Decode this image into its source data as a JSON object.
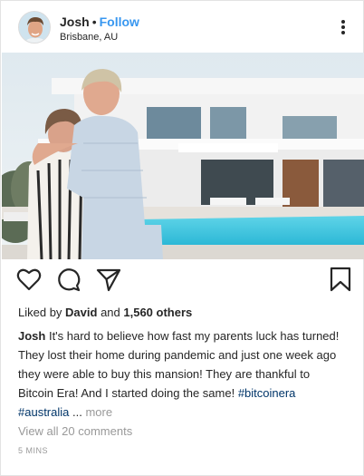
{
  "post": {
    "username": "Josh",
    "separator": "•",
    "follow_label": "Follow",
    "location": "Brisbane, AU",
    "more_icon": "more-vertical-icon"
  },
  "photo": {
    "description_icon": "post-photo"
  },
  "actions": {
    "like_icon": "heart-icon",
    "comment_icon": "comment-icon",
    "share_icon": "share-icon",
    "save_icon": "bookmark-icon"
  },
  "likes": {
    "prefix": "Liked by ",
    "user": "David",
    "and": " and ",
    "count": "1,560 others"
  },
  "caption": {
    "author": "Josh",
    "text": " It's hard to believe how fast my parents luck has turned! They lost their home during pandemic and just one week ago they were able to buy this mansion! They are thankful to Bitcoin Era! And I started doing the same! ",
    "tag1": "#bitcoinera",
    "tag2": "#australia",
    "ellipsis": " ... ",
    "more": "more"
  },
  "comments_link": "View all 20 comments",
  "timestamp": "5 MINS",
  "colors": {
    "link_blue": "#3897f0",
    "hashtag": "#003569",
    "muted": "#999999"
  }
}
